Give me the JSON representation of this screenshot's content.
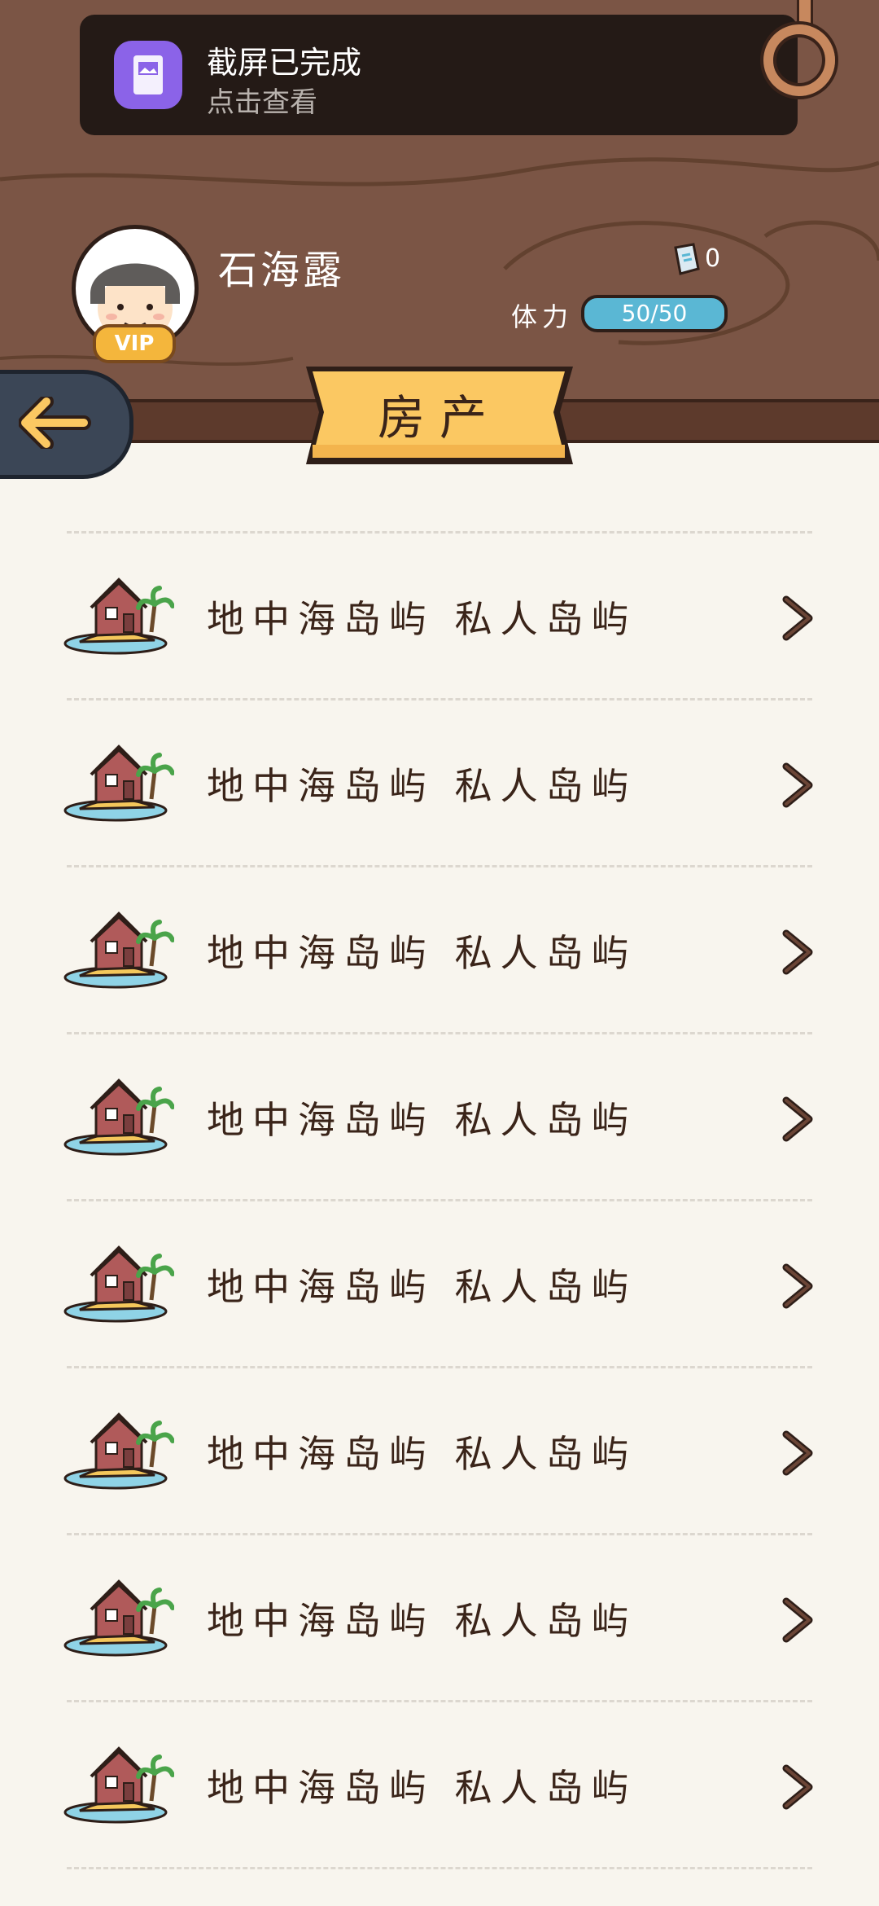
{
  "notification": {
    "title": "截屏已完成",
    "subtitle": "点击查看"
  },
  "profile": {
    "name": "石海露",
    "vip_label": "VIP",
    "ticket_count": "0",
    "stamina_label": "体力",
    "stamina_value": "50/50"
  },
  "page": {
    "title": "房产"
  },
  "properties": [
    {
      "label": "地中海岛屿 私人岛屿"
    },
    {
      "label": "地中海岛屿 私人岛屿"
    },
    {
      "label": "地中海岛屿 私人岛屿"
    },
    {
      "label": "地中海岛屿 私人岛屿"
    },
    {
      "label": "地中海岛屿 私人岛屿"
    },
    {
      "label": "地中海岛屿 私人岛屿"
    },
    {
      "label": "地中海岛屿 私人岛屿"
    },
    {
      "label": "地中海岛屿 私人岛屿"
    }
  ],
  "colors": {
    "wood": "#7b5545",
    "banner": "#fbc862",
    "stamina": "#5ab7d4",
    "background": "#f8f5ee"
  }
}
